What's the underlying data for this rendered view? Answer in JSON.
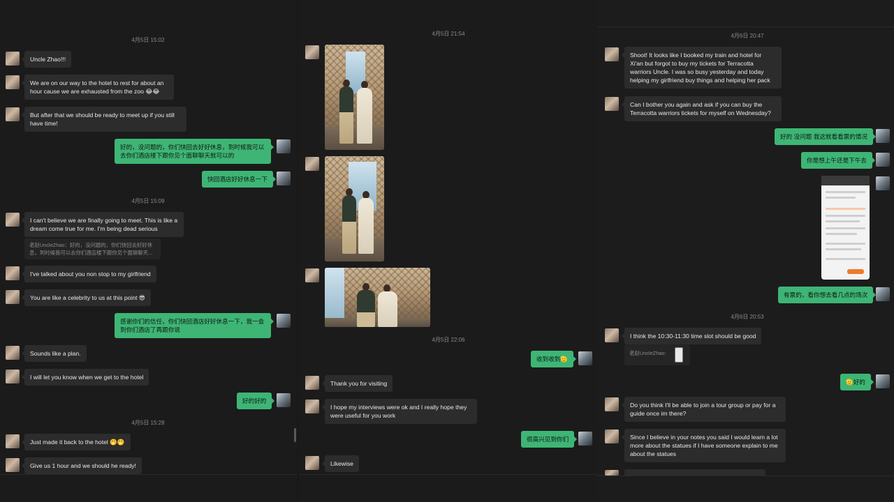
{
  "panel1": {
    "timestamps": [
      "4月5日 15:02",
      "4月5日 15:09",
      "4月5日 15:28"
    ],
    "messages": [
      "Uncle Zhao!!!",
      "We are on our way to the hotel to rest for about an hour cause we are exhausted from the zoo 😂😂",
      "But after that we should be ready to meet up if you still have time!",
      "好的，没问题的，你们快回去好好休息，到时候我可以去你们酒店楼下跟你见个面聊聊天就可以的",
      "快回酒店好好休息一下",
      "I can't believe we are finally going to meet. This is like a dream come true for me. I'm being dead serious",
      "老赵UncleZhao：好的，没问题的，你们快回去好好休息，到时候我可以去你们酒店楼下跟你见个面聊聊天...",
      "I've talked about you non stop to my girlfriend",
      "You are like a celebrity to us at this point 😎",
      "感谢你们的信任，你们快回酒店好好休息一下，我一会到你们酒店了再跟你说",
      "Sounds like a plan.",
      "I will let you know when we get to the hotel",
      "好的好的",
      "Just made it back to the hotel 🤭🤭",
      "Give us 1 hour and we should he ready!"
    ]
  },
  "panel2": {
    "timestamps": [
      "4月5日 21:54",
      "4月5日 22:06"
    ],
    "messages": [
      "收到收到🫡",
      "Thank you for visiting",
      "I hope my interviews were ok and I really hope they were useful for you work",
      "很高兴见到你们",
      "Likewise"
    ]
  },
  "panel3": {
    "timestamps": [
      "4月6日 20:47",
      "4月6日 20:53"
    ],
    "messages": [
      "Shoot! It looks like I booked my train and hotel for Xi'an but forgot to buy my tickets for Terracotta warriors Uncle. I was so busy yesterday and today helping my girlfriend buy things and helping her pack",
      "Can I bother you again and ask if you can buy the Terracotta warriors tickets for myself on Wednesday?",
      "好的 没问题 我这就看看票的情况",
      "你是想上午还是下午去",
      "有票的，看你想去看几点的场次",
      "I think the 10:30-11:30 time slot should be good",
      "老赵UncleZhao:",
      "🫡好的",
      "Do you think I'll be able to join a tour group or pay for a guide once im there?",
      "Since I believe in your notes you said I would learn a lot more about the statues if I have someone explain to me about the statues"
    ]
  }
}
